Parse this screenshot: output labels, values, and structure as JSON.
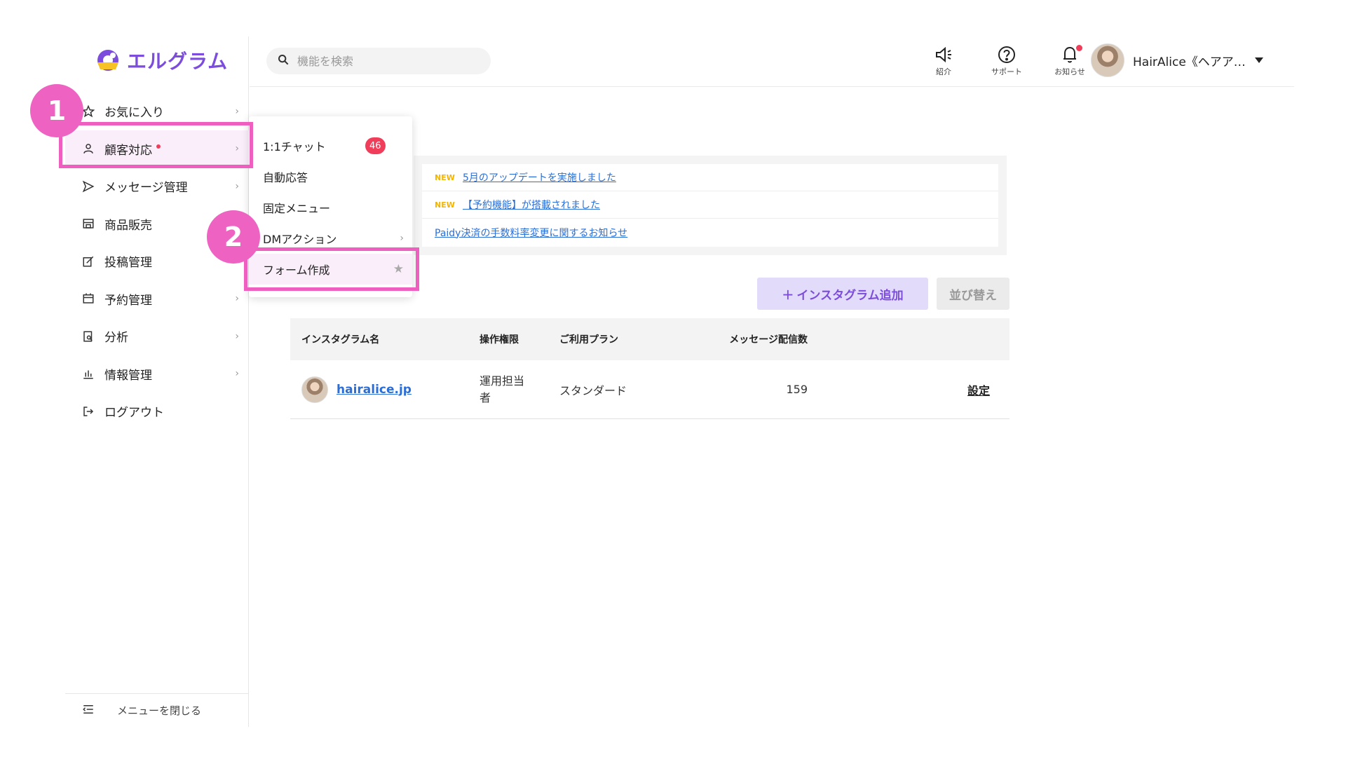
{
  "logo": {
    "text": "エルグラム",
    "brand_color": "#7c4ddc"
  },
  "search": {
    "placeholder": "機能を検索"
  },
  "topbar": {
    "tools": [
      {
        "icon": "megaphone-icon",
        "label": "紹介"
      },
      {
        "icon": "help-icon",
        "label": "サポート"
      },
      {
        "icon": "bell-icon",
        "label": "お知らせ"
      }
    ],
    "user_name": "HairAlice《ヘアア…"
  },
  "sidebar": {
    "items": [
      {
        "label": "お気に入り",
        "icon": "star-icon"
      },
      {
        "label": "顧客対応",
        "icon": "user-icon"
      },
      {
        "label": "メッセージ管理",
        "icon": "send-icon"
      },
      {
        "label": "商品販売",
        "icon": "store-icon"
      },
      {
        "label": "投稿管理",
        "icon": "edit-icon"
      },
      {
        "label": "予約管理",
        "icon": "calendar-icon"
      },
      {
        "label": "分析",
        "icon": "search-doc-icon"
      },
      {
        "label": "情報管理",
        "icon": "bar-chart-icon"
      },
      {
        "label": "ログアウト",
        "icon": "logout-icon"
      }
    ],
    "close_label": "メニューを閉じる"
  },
  "submenu": {
    "items": [
      {
        "label": "1:1チャット",
        "badge": "46"
      },
      {
        "label": "自動応答"
      },
      {
        "label": "固定メニュー"
      },
      {
        "label": "DMアクション"
      },
      {
        "label": "フォーム作成"
      }
    ]
  },
  "steps": [
    "1",
    "2"
  ],
  "news": [
    {
      "new": "NEW",
      "text": "5月のアップデートを実施しました"
    },
    {
      "new": "NEW",
      "text": "【予約機能】が搭載されました"
    },
    {
      "new": "",
      "text": "Paidy決済の手数料率変更に関するお知らせ"
    }
  ],
  "actions": {
    "add": "インスタグラム追加",
    "sort": "並び替え"
  },
  "table": {
    "headers": [
      "インスタグラム名",
      "操作権限",
      "ご利用プラン",
      "メッセージ配信数"
    ],
    "rows": [
      {
        "name": "hairalice.jp",
        "role": "運用担当者",
        "plan": "スタンダード",
        "count": "159",
        "action": "設定"
      }
    ]
  },
  "colors": {
    "highlight": "#ef5fc0",
    "badge": "#f03e5a",
    "accent": "#7c4ddc",
    "link": "#2b6fd6"
  }
}
